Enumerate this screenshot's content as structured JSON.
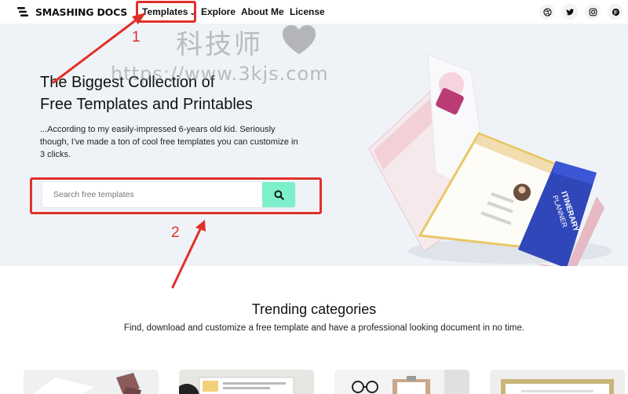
{
  "nav": {
    "brand": "SMASHING DOCS",
    "links": [
      {
        "label": "Templates",
        "has_dropdown": true
      },
      {
        "label": "Explore"
      },
      {
        "label": "About Me"
      },
      {
        "label": "License"
      }
    ],
    "socials": [
      "dribbble-icon",
      "twitter-icon",
      "instagram-icon",
      "pinterest-icon"
    ]
  },
  "hero": {
    "title_line1": "The Biggest Collection of",
    "title_line2": "Free Templates and Printables",
    "description": "...According to my easily-impressed 6-years old kid. Seriously though, I've made a ton of cool free templates you can customize in 3 clicks.",
    "search": {
      "placeholder": "Search free templates",
      "value": ""
    },
    "art_text": {
      "itinerary_line1": "ITINERARY",
      "itinerary_line2": "PLANNER"
    }
  },
  "watermark": {
    "chinese": "科技师",
    "url": "https://www.3kjs.com"
  },
  "annotations": {
    "label_1": "1",
    "label_2": "2"
  },
  "trending": {
    "title": "Trending categories",
    "subtitle": "Find, download and customize a free template and have a professional looking document in no time."
  },
  "colors": {
    "search_button": "#7cf0cb",
    "annotation": "#e0302a",
    "hero_bg": "#eff3f8",
    "itinerary": "#2f47b8",
    "resume_accent": "#e9c766"
  }
}
